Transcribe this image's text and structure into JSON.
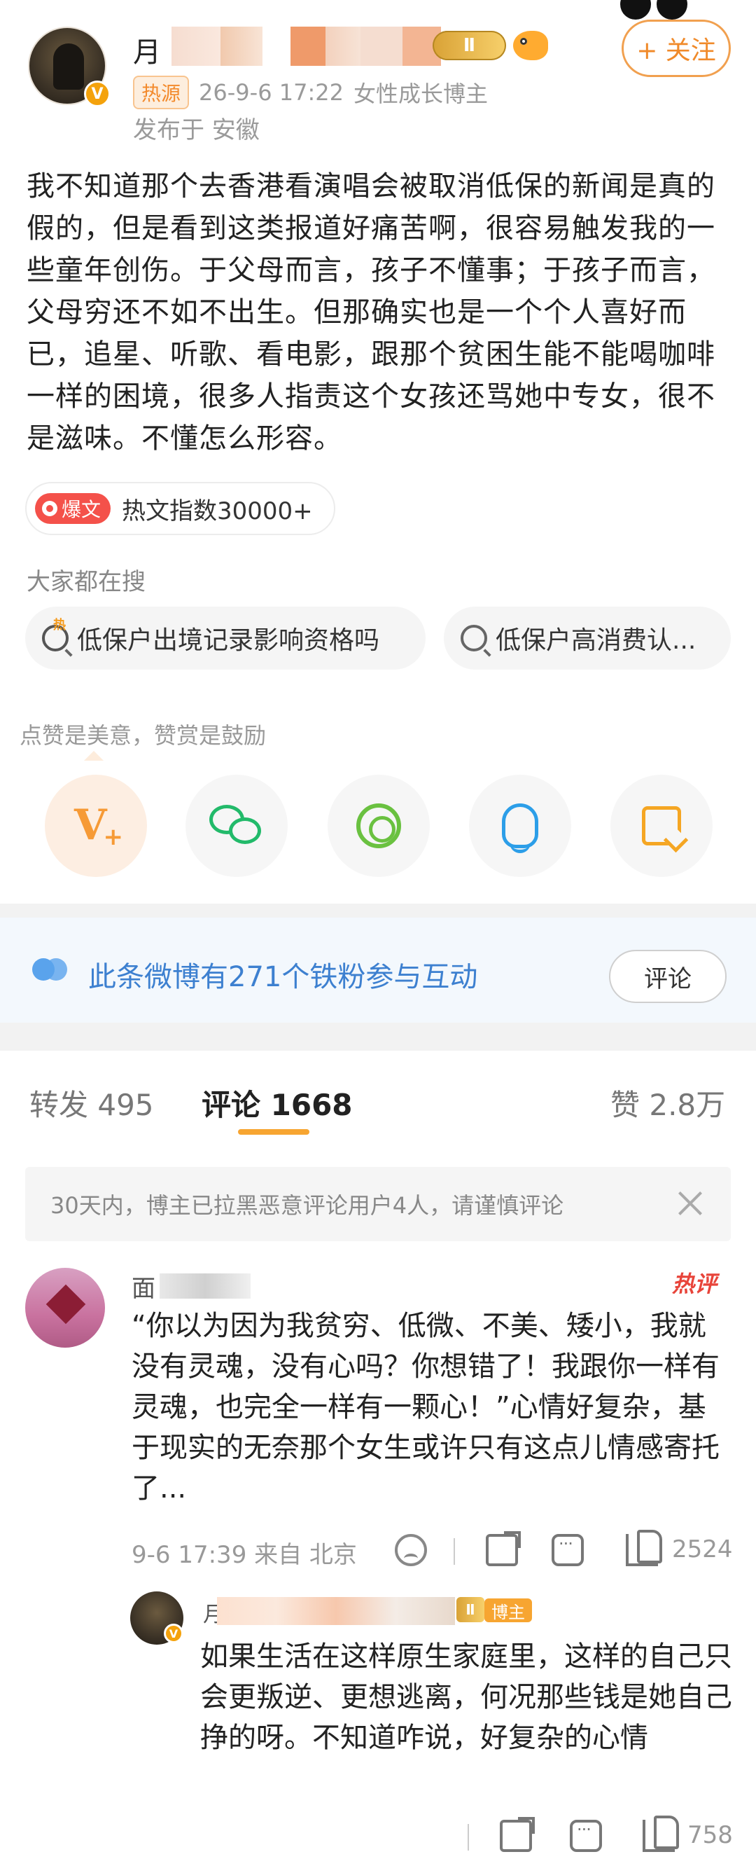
{
  "post": {
    "author_name": "月",
    "author_level": "Ⅱ",
    "follow_label": "+ 关注",
    "hot_tag": "热源",
    "time": "26-9-6 17:22",
    "author_title": "女性成长博主",
    "location": "发布于 安徽",
    "content": "我不知道那个去香港看演唱会被取消低保的新闻是真的假的，但是看到这类报道好痛苦啊，很容易触发我的一些童年创伤。于父母而言，孩子不懂事；于孩子而言，父母穷还不如不出生。但那确实也是一个个人喜好而已，追星、听歌、看电影，跟那个贫困生能不能喝咖啡一样的困境，很多人指责这个女孩还骂她中专女，很不是滋味。不懂怎么形容。",
    "hot_badge": "爆文",
    "hot_index": "热文指数30000+"
  },
  "search": {
    "title": "大家都在搜",
    "items": [
      "低保户出境记录影响资格吗",
      "低保户高消费认..."
    ]
  },
  "reward": {
    "text": "点赞是美意，赞赏是鼓励"
  },
  "fans": {
    "text": "此条微博有271个铁粉参与互动",
    "button": "评论"
  },
  "tabs": {
    "repost": "转发 495",
    "comment": "评论 1668",
    "like": "赞 2.8万"
  },
  "notice": {
    "text": "30天内，博主已拉黑恶意评论用户4人，请谨慎评论"
  },
  "comment": {
    "name": "面",
    "hot_label": "热评",
    "text": "“你以为因为我贫穷、低微、不美、矮小，我就没有灵魂，没有心吗？你想错了！我跟你一样有灵魂，也完全一样有一颗心！”心情好复杂，基于现实的无奈那个女生或许只有这点儿情感寄托了...",
    "time": "9-6 17:39 来自 北京",
    "likes": "2524"
  },
  "reply": {
    "name": "月",
    "level": "Ⅱ",
    "author_tag": "博主",
    "text": "如果生活在这样原生家庭里，这样的自己只会更叛逆、更想逃离，何况那些钱是她自己挣的呀。不知道咋说，好复杂的心情",
    "likes": "758"
  }
}
